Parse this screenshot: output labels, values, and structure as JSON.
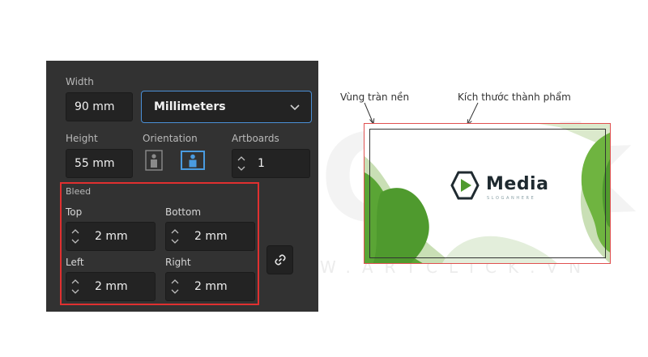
{
  "watermark": {
    "big": "Click",
    "small": "W.ARTCLICK.VN"
  },
  "panel": {
    "width": {
      "label": "Width",
      "value": "90 mm"
    },
    "unit": {
      "selected": "Millimeters"
    },
    "height": {
      "label": "Height",
      "value": "55 mm"
    },
    "orientation": {
      "label": "Orientation",
      "selected": "landscape"
    },
    "artboards": {
      "label": "Artboards",
      "value": "1"
    },
    "bleed": {
      "label": "Bleed",
      "top": {
        "label": "Top",
        "value": "2 mm"
      },
      "bottom": {
        "label": "Bottom",
        "value": "2 mm"
      },
      "left": {
        "label": "Left",
        "value": "2 mm"
      },
      "right": {
        "label": "Right",
        "value": "2 mm"
      }
    }
  },
  "diagram": {
    "bleed_label": "Vùng tràn nền",
    "trim_label": "Kích thước thành phẩm",
    "card": {
      "brand": "Media",
      "slogan": "SLOGANHERE"
    }
  },
  "colors": {
    "panel_bg": "#323232",
    "field_bg": "#232323",
    "focus_blue": "#4a8fd6",
    "bleed_red": "#e03030",
    "green_dark": "#4f9a2e",
    "green_light": "#c9dfb5"
  }
}
